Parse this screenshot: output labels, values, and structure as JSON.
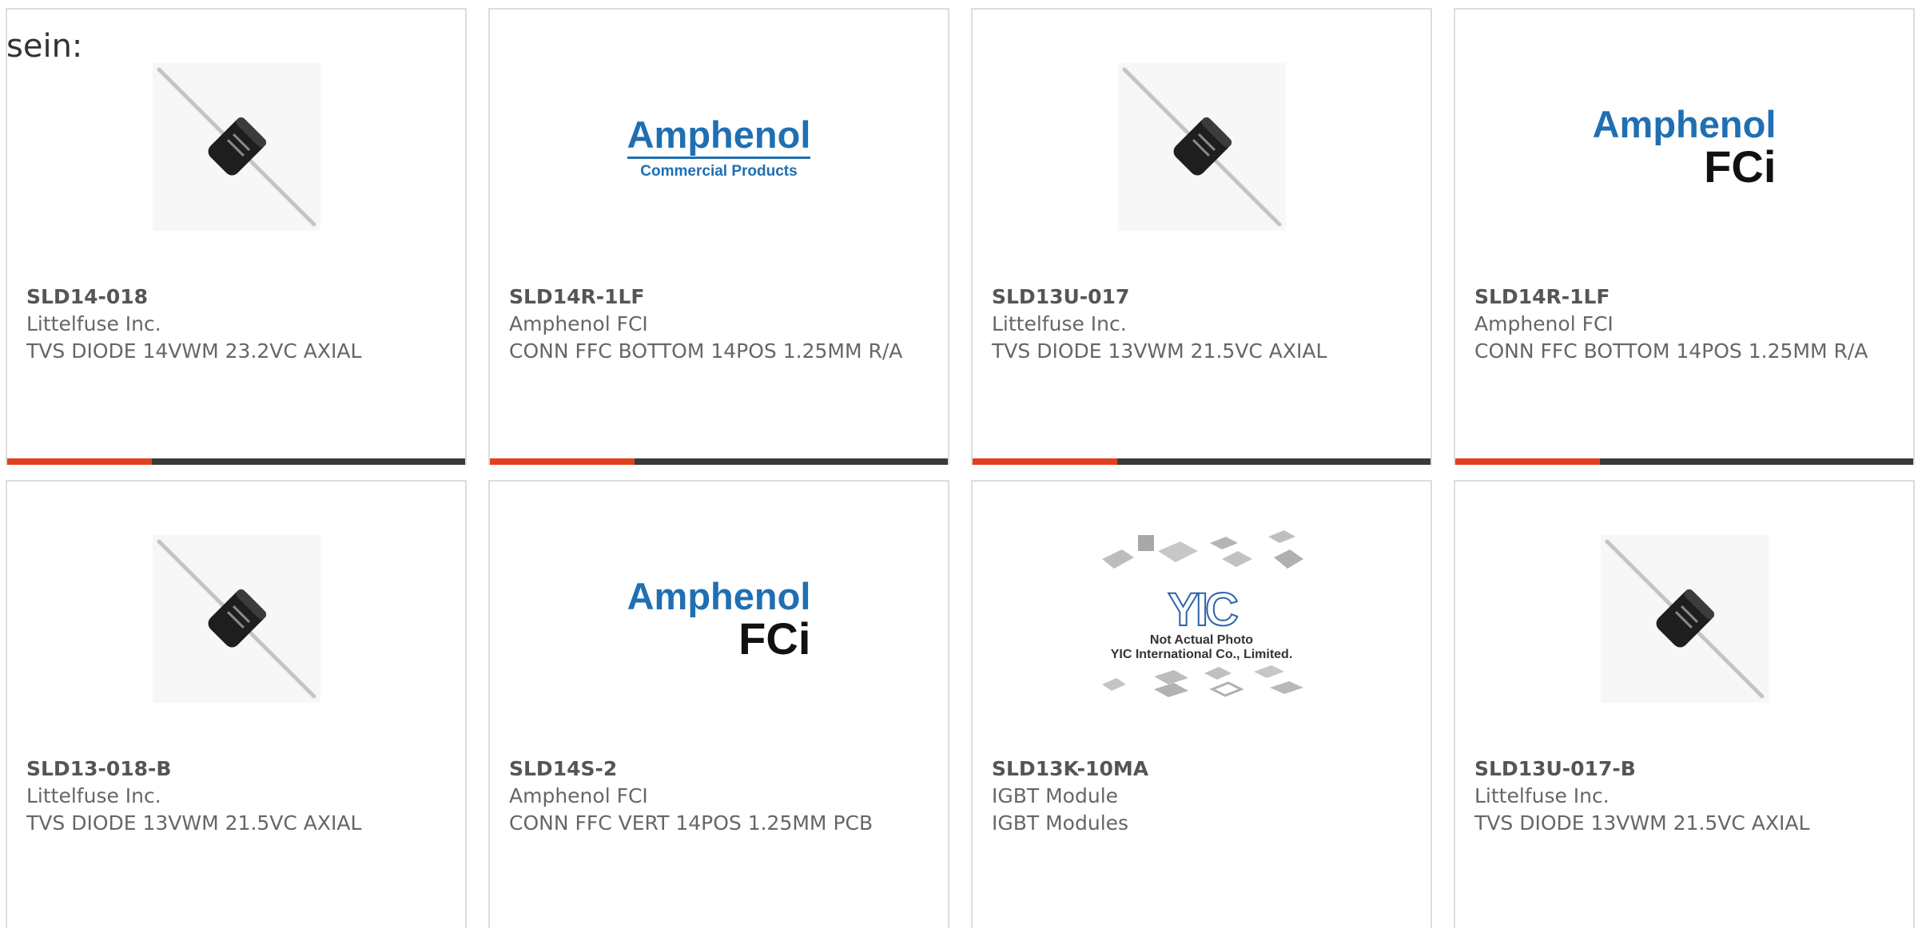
{
  "intro_text": "sein:",
  "colors": {
    "accent": "#e2401c",
    "bar_track": "#3a3a3a",
    "card_border": "#dddddd",
    "amphenol_blue": "#1f6fb2"
  },
  "brands": {
    "amphenol": "Amphenol",
    "commercial_products": "Commercial Products",
    "fci": "FCi",
    "yic_mark": "YIC",
    "yic_caption_line1": "Not Actual Photo",
    "yic_caption_line2": "YIC International Co., Limited."
  },
  "products": [
    {
      "part_number": "SLD14-018",
      "manufacturer": "Littelfuse Inc.",
      "description": "TVS DIODE 14VWM 23.2VC AXIAL",
      "image": "axial-diode-image",
      "progress": 0.316
    },
    {
      "part_number": "SLD14R-1LF",
      "manufacturer": "Amphenol FCI",
      "description": "CONN FFC BOTTOM 14POS 1.25MM R/A",
      "image": "amphenol-commercial-products-logo",
      "progress": 0.316
    },
    {
      "part_number": "SLD13U-017",
      "manufacturer": "Littelfuse Inc.",
      "description": "TVS DIODE 13VWM 21.5VC AXIAL",
      "image": "axial-diode-image",
      "progress": 0.316
    },
    {
      "part_number": "SLD14R-1LF",
      "manufacturer": "Amphenol FCI",
      "description": "CONN FFC BOTTOM 14POS 1.25MM R/A",
      "image": "amphenol-fci-logo",
      "progress": 0.316
    },
    {
      "part_number": "SLD13-018-B",
      "manufacturer": "Littelfuse Inc.",
      "description": "TVS DIODE 13VWM 21.5VC AXIAL",
      "image": "axial-diode-image"
    },
    {
      "part_number": "SLD14S-2",
      "manufacturer": "Amphenol FCI",
      "description": "CONN FFC VERT 14POS 1.25MM PCB",
      "image": "amphenol-fci-logo"
    },
    {
      "part_number": "SLD13K-10MA",
      "manufacturer": "IGBT Module",
      "description": "IGBT Modules",
      "image": "yic-not-actual-photo-image"
    },
    {
      "part_number": "SLD13U-017-B",
      "manufacturer": "Littelfuse Inc.",
      "description": "TVS DIODE 13VWM 21.5VC AXIAL",
      "image": "axial-diode-image"
    }
  ]
}
